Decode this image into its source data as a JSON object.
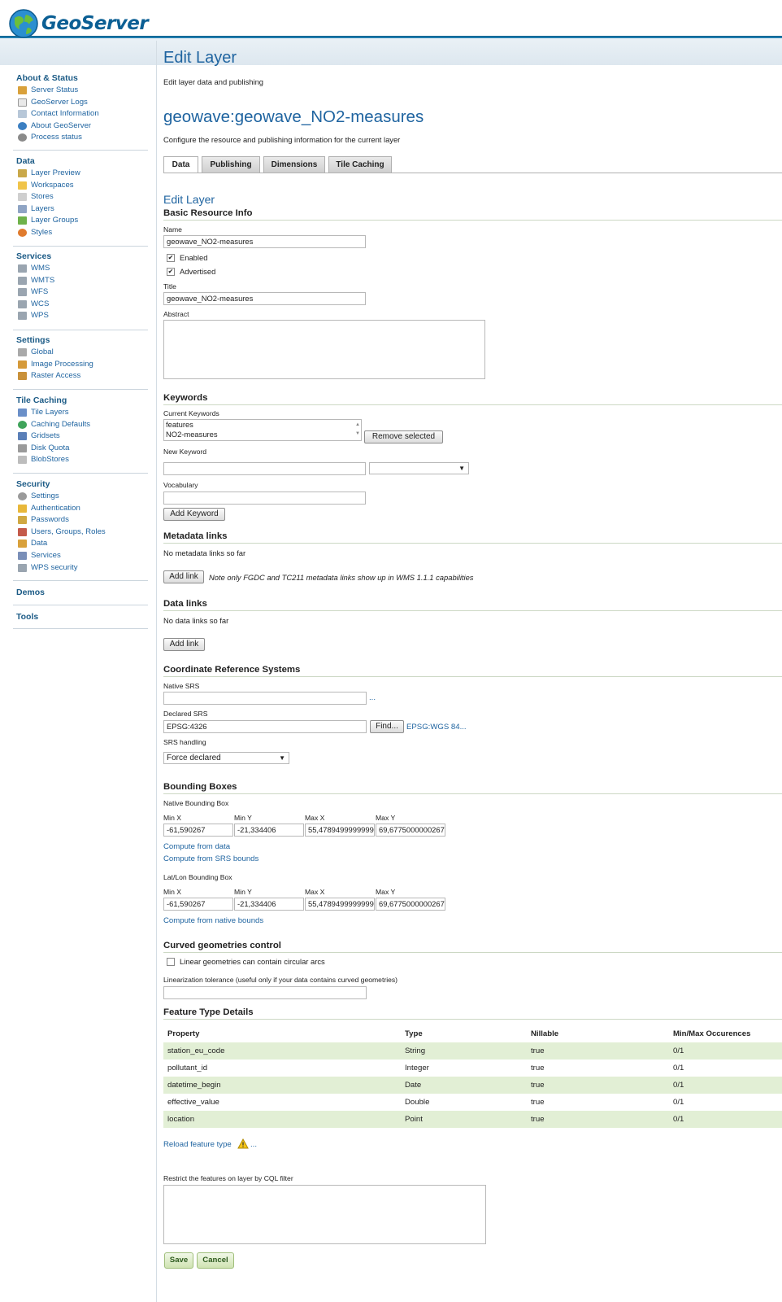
{
  "app": {
    "name": "GeoServer"
  },
  "sidebar": {
    "sections": [
      {
        "title": "About & Status",
        "items": [
          {
            "label": "Server Status",
            "icon": "server-status-icon"
          },
          {
            "label": "GeoServer Logs",
            "icon": "logs-icon"
          },
          {
            "label": "Contact Information",
            "icon": "contact-icon"
          },
          {
            "label": "About GeoServer",
            "icon": "about-icon"
          },
          {
            "label": "Process status",
            "icon": "process-icon"
          }
        ]
      },
      {
        "title": "Data",
        "items": [
          {
            "label": "Layer Preview",
            "icon": "layer-preview-icon"
          },
          {
            "label": "Workspaces",
            "icon": "workspaces-icon"
          },
          {
            "label": "Stores",
            "icon": "stores-icon"
          },
          {
            "label": "Layers",
            "icon": "layers-icon"
          },
          {
            "label": "Layer Groups",
            "icon": "layer-groups-icon"
          },
          {
            "label": "Styles",
            "icon": "styles-icon"
          }
        ]
      },
      {
        "title": "Services",
        "items": [
          {
            "label": "WMS",
            "icon": "wms-icon"
          },
          {
            "label": "WMTS",
            "icon": "wmts-icon"
          },
          {
            "label": "WFS",
            "icon": "wfs-icon"
          },
          {
            "label": "WCS",
            "icon": "wcs-icon"
          },
          {
            "label": "WPS",
            "icon": "wps-icon"
          }
        ]
      },
      {
        "title": "Settings",
        "items": [
          {
            "label": "Global",
            "icon": "global-icon"
          },
          {
            "label": "Image Processing",
            "icon": "image-processing-icon"
          },
          {
            "label": "Raster Access",
            "icon": "raster-access-icon"
          }
        ]
      },
      {
        "title": "Tile Caching",
        "items": [
          {
            "label": "Tile Layers",
            "icon": "tile-layers-icon"
          },
          {
            "label": "Caching Defaults",
            "icon": "caching-defaults-icon"
          },
          {
            "label": "Gridsets",
            "icon": "gridsets-icon"
          },
          {
            "label": "Disk Quota",
            "icon": "disk-quota-icon"
          },
          {
            "label": "BlobStores",
            "icon": "blobstores-icon"
          }
        ]
      },
      {
        "title": "Security",
        "items": [
          {
            "label": "Settings",
            "icon": "security-settings-icon"
          },
          {
            "label": "Authentication",
            "icon": "authentication-icon"
          },
          {
            "label": "Passwords",
            "icon": "passwords-icon"
          },
          {
            "label": "Users, Groups, Roles",
            "icon": "users-icon"
          },
          {
            "label": "Data",
            "icon": "data-security-icon"
          },
          {
            "label": "Services",
            "icon": "services-security-icon"
          },
          {
            "label": "WPS security",
            "icon": "wps-security-icon"
          }
        ]
      },
      {
        "title": "Demos",
        "items": []
      },
      {
        "title": "Tools",
        "items": []
      }
    ]
  },
  "page": {
    "title": "Edit Layer",
    "subtitle": "Edit layer data and publishing",
    "layer_title": "geowave:geowave_NO2-measures",
    "layer_desc": "Configure the resource and publishing information for the current layer"
  },
  "tabs": [
    {
      "label": "Data"
    },
    {
      "label": "Publishing"
    },
    {
      "label": "Dimensions"
    },
    {
      "label": "Tile Caching"
    }
  ],
  "form": {
    "heading": "Edit Layer",
    "basic": {
      "title": "Basic Resource Info",
      "name_label": "Name",
      "name_value": "geowave_NO2-measures",
      "enabled_label": "Enabled",
      "enabled": "✔",
      "advertised_label": "Advertised",
      "advertised": "✔",
      "title_label": "Title",
      "title_value": "geowave_NO2-measures",
      "abstract_label": "Abstract"
    },
    "keywords": {
      "title": "Keywords",
      "current_label": "Current Keywords",
      "items": [
        "features",
        "NO2-measures"
      ],
      "remove_label": "Remove selected",
      "new_label": "New Keyword",
      "vocab_label": "Vocabulary",
      "add_label": "Add Keyword"
    },
    "metadata": {
      "title": "Metadata links",
      "empty": "No metadata links so far",
      "add_label": "Add link",
      "note": "Note only FGDC and TC211 metadata links show up in WMS 1.1.1 capabilities"
    },
    "datalinks": {
      "title": "Data links",
      "empty": "No data links so far",
      "add_label": "Add link"
    },
    "crs": {
      "title": "Coordinate Reference Systems",
      "native_label": "Native SRS",
      "native_value": "",
      "native_more": "...",
      "declared_label": "Declared SRS",
      "declared_value": "EPSG:4326",
      "find_label": "Find...",
      "declared_link": "EPSG:WGS 84...",
      "handling_label": "SRS handling",
      "handling_value": "Force declared"
    },
    "bbox": {
      "title": "Bounding Boxes",
      "native_label": "Native Bounding Box",
      "latlon_label": "Lat/Lon Bounding Box",
      "col_labels": [
        "Min X",
        "Min Y",
        "Max X",
        "Max Y"
      ],
      "native_values": [
        "-61,590267",
        "-21,334406",
        "55,4789499999999",
        "69,6775000000267"
      ],
      "latlon_values": [
        "-61,590267",
        "-21,334406",
        "55,4789499999999",
        "69,6775000000267"
      ],
      "compute_data": "Compute from data",
      "compute_srs": "Compute from SRS bounds",
      "compute_native": "Compute from native bounds"
    },
    "curved": {
      "title": "Curved geometries control",
      "checkbox_label": "Linear geometries can contain circular arcs",
      "tol_label": "Linearization tolerance (useful only if your data contains curved geometries)"
    },
    "feature": {
      "title": "Feature Type Details",
      "headers": [
        "Property",
        "Type",
        "Nillable",
        "Min/Max Occurences"
      ],
      "rows": [
        [
          "station_eu_code",
          "String",
          "true",
          "0/1"
        ],
        [
          "pollutant_id",
          "Integer",
          "true",
          "0/1"
        ],
        [
          "datetime_begin",
          "Date",
          "true",
          "0/1"
        ],
        [
          "effective_value",
          "Double",
          "true",
          "0/1"
        ],
        [
          "location",
          "Point",
          "true",
          "0/1"
        ]
      ],
      "reload_label": "Reload feature type",
      "reload_more": "..."
    },
    "cql": {
      "label": "Restrict the features on layer by CQL filter"
    },
    "save_label": "Save",
    "cancel_label": "Cancel"
  }
}
